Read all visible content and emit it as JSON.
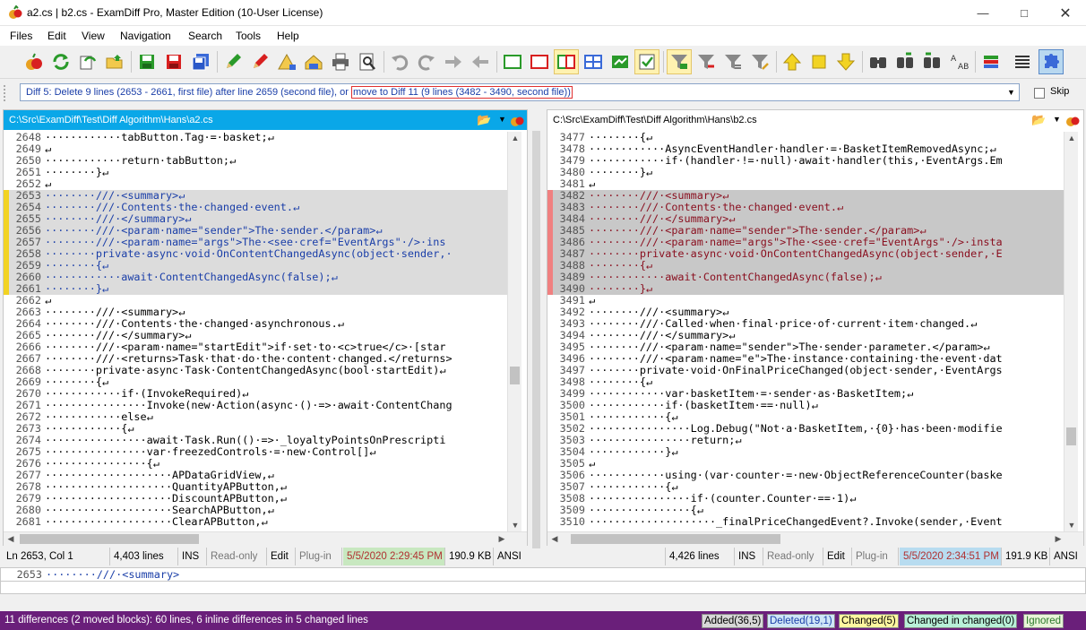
{
  "window": {
    "title": "a2.cs  |  b2.cs - ExamDiff Pro, Master Edition (10-User License)"
  },
  "menu": [
    "Files",
    "Edit",
    "View",
    "Navigation",
    "Search",
    "Tools",
    "Help"
  ],
  "diffnav": {
    "text": "Diff 5: Delete 9 lines (2653 - 2661, first file) after line 2659 (second file), or",
    "move_link": "move to Diff 11 (9 lines (3482 - 3490, second file))",
    "skip_label": "Skip"
  },
  "left": {
    "path": "C:\\Src\\ExamDiff\\Test\\Diff Algorithm\\Hans\\a2.cs",
    "lines": [
      {
        "n": "2648",
        "t": "············tabButton.Tag·=·basket;↵",
        "k": ""
      },
      {
        "n": "2649",
        "t": "↵",
        "k": ""
      },
      {
        "n": "2650",
        "t": "············return·tabButton;↵",
        "k": ""
      },
      {
        "n": "2651",
        "t": "········}↵",
        "k": ""
      },
      {
        "n": "2652",
        "t": "↵",
        "k": ""
      },
      {
        "n": "2653",
        "t": "········///·<summary>↵",
        "k": "del"
      },
      {
        "n": "2654",
        "t": "········///·Contents·the·changed·event.↵",
        "k": "del"
      },
      {
        "n": "2655",
        "t": "········///·</summary>↵",
        "k": "del"
      },
      {
        "n": "2656",
        "t": "········///·<param·name=\"sender\">The·sender.</param>↵",
        "k": "del"
      },
      {
        "n": "2657",
        "t": "········///·<param·name=\"args\">The·<see·cref=\"EventArgs\"·/>·ins",
        "k": "del"
      },
      {
        "n": "2658",
        "t": "········private·async·void·OnContentChangedAsync(object·sender,·",
        "k": "del"
      },
      {
        "n": "2659",
        "t": "········{↵",
        "k": "del"
      },
      {
        "n": "2660",
        "t": "············await·ContentChangedAsync(false);↵",
        "k": "del"
      },
      {
        "n": "2661",
        "t": "········}↵",
        "k": "del"
      },
      {
        "n": "2662",
        "t": "↵",
        "k": ""
      },
      {
        "n": "2663",
        "t": "········///·<summary>↵",
        "k": ""
      },
      {
        "n": "2664",
        "t": "········///·Contents·the·changed·asynchronous.↵",
        "k": ""
      },
      {
        "n": "2665",
        "t": "········///·</summary>↵",
        "k": ""
      },
      {
        "n": "2666",
        "t": "········///·<param·name=\"startEdit\">if·set·to·<c>true</c>·[star",
        "k": ""
      },
      {
        "n": "2667",
        "t": "········///·<returns>Task·that·do·the·content·changed.</returns>",
        "k": ""
      },
      {
        "n": "2668",
        "t": "········private·async·Task·ContentChangedAsync(bool·startEdit)↵",
        "k": ""
      },
      {
        "n": "2669",
        "t": "········{↵",
        "k": ""
      },
      {
        "n": "2670",
        "t": "············if·(InvokeRequired)↵",
        "k": ""
      },
      {
        "n": "2671",
        "t": "················Invoke(new·Action(async·()·=>·await·ContentChang",
        "k": ""
      },
      {
        "n": "2672",
        "t": "············else↵",
        "k": ""
      },
      {
        "n": "2673",
        "t": "············{↵",
        "k": ""
      },
      {
        "n": "2674",
        "t": "················await·Task.Run(()·=>·_loyaltyPointsOnPrescripti",
        "k": ""
      },
      {
        "n": "2675",
        "t": "················var·freezedControls·=·new·Control[]↵",
        "k": ""
      },
      {
        "n": "2676",
        "t": "················{↵",
        "k": ""
      },
      {
        "n": "2677",
        "t": "····················APDataGridView,↵",
        "k": ""
      },
      {
        "n": "2678",
        "t": "····················QuantityAPButton,↵",
        "k": ""
      },
      {
        "n": "2679",
        "t": "····················DiscountAPButton,↵",
        "k": ""
      },
      {
        "n": "2680",
        "t": "····················SearchAPButton,↵",
        "k": ""
      },
      {
        "n": "2681",
        "t": "····················ClearAPButton,↵",
        "k": ""
      }
    ],
    "status": {
      "pos": "Ln 2653, Col 1",
      "lines": "4,403 lines",
      "ins": "INS",
      "ro": "Read-only",
      "edit": "Edit",
      "plugin": "Plug-in",
      "date": "5/5/2020 2:29:45 PM",
      "size": "190.9 KB",
      "enc": "ANSI"
    }
  },
  "right": {
    "path": "C:\\Src\\ExamDiff\\Test\\Diff Algorithm\\Hans\\b2.cs",
    "lines": [
      {
        "n": "3477",
        "t": "········{↵",
        "k": ""
      },
      {
        "n": "3478",
        "t": "············AsyncEventHandler·handler·=·BasketItemRemovedAsync;↵",
        "k": ""
      },
      {
        "n": "3479",
        "t": "············if·(handler·!=·null)·await·handler(this,·EventArgs.Em",
        "k": ""
      },
      {
        "n": "3480",
        "t": "········}↵",
        "k": ""
      },
      {
        "n": "3481",
        "t": "↵",
        "k": ""
      },
      {
        "n": "3482",
        "t": "········///·<summary>↵",
        "k": "add"
      },
      {
        "n": "3483",
        "t": "········///·Contents·the·changed·event.↵",
        "k": "add"
      },
      {
        "n": "3484",
        "t": "········///·</summary>↵",
        "k": "add"
      },
      {
        "n": "3485",
        "t": "········///·<param·name=\"sender\">The·sender.</param>↵",
        "k": "add"
      },
      {
        "n": "3486",
        "t": "········///·<param·name=\"args\">The·<see·cref=\"EventArgs\"·/>·insta",
        "k": "add"
      },
      {
        "n": "3487",
        "t": "········private·async·void·OnContentChangedAsync(object·sender,·E",
        "k": "add"
      },
      {
        "n": "3488",
        "t": "········{↵",
        "k": "add"
      },
      {
        "n": "3489",
        "t": "············await·ContentChangedAsync(false);↵",
        "k": "add"
      },
      {
        "n": "3490",
        "t": "········}↵",
        "k": "add"
      },
      {
        "n": "3491",
        "t": "↵",
        "k": ""
      },
      {
        "n": "3492",
        "t": "········///·<summary>↵",
        "k": ""
      },
      {
        "n": "3493",
        "t": "········///·Called·when·final·price·of·current·item·changed.↵",
        "k": ""
      },
      {
        "n": "3494",
        "t": "········///·</summary>↵",
        "k": ""
      },
      {
        "n": "3495",
        "t": "········///·<param·name=\"sender\">The·sender·parameter.</param>↵",
        "k": ""
      },
      {
        "n": "3496",
        "t": "········///·<param·name=\"e\">The·instance·containing·the·event·dat",
        "k": ""
      },
      {
        "n": "3497",
        "t": "········private·void·OnFinalPriceChanged(object·sender,·EventArgs",
        "k": ""
      },
      {
        "n": "3498",
        "t": "········{↵",
        "k": ""
      },
      {
        "n": "3499",
        "t": "············var·basketItem·=·sender·as·BasketItem;↵",
        "k": ""
      },
      {
        "n": "3500",
        "t": "············if·(basketItem·==·null)↵",
        "k": ""
      },
      {
        "n": "3501",
        "t": "············{↵",
        "k": ""
      },
      {
        "n": "3502",
        "t": "················Log.Debug(\"Not·a·BasketItem,·{0}·has·been·modifie",
        "k": ""
      },
      {
        "n": "3503",
        "t": "················return;↵",
        "k": ""
      },
      {
        "n": "3504",
        "t": "············}↵",
        "k": ""
      },
      {
        "n": "3505",
        "t": "↵",
        "k": ""
      },
      {
        "n": "3506",
        "t": "············using·(var·counter·=·new·ObjectReferenceCounter(baske",
        "k": ""
      },
      {
        "n": "3507",
        "t": "············{↵",
        "k": ""
      },
      {
        "n": "3508",
        "t": "················if·(counter.Counter·==·1)↵",
        "k": ""
      },
      {
        "n": "3509",
        "t": "················{↵",
        "k": ""
      },
      {
        "n": "3510",
        "t": "····················_finalPriceChangedEvent?.Invoke(sender,·Event",
        "k": ""
      }
    ],
    "status": {
      "lines": "4,426 lines",
      "ins": "INS",
      "ro": "Read-only",
      "edit": "Edit",
      "plugin": "Plug-in",
      "date": "5/5/2020 2:34:51 PM",
      "size": "191.9 KB",
      "enc": "ANSI"
    }
  },
  "bottom": {
    "line_number": "2653",
    "line_text": "········///·<summary>"
  },
  "summary": {
    "text": "11 differences (2 moved blocks): 60 lines, 6 inline differences in 5 changed lines",
    "badges": [
      "Added(36,5)",
      "Deleted(19,1)",
      "Changed(5)",
      "Changed in changed(0)",
      "Ignored"
    ]
  },
  "colors": {
    "accent": "#0aa7e8",
    "deleted_bg": "#dcdcdc",
    "added_bg": "#c8c8c8",
    "moved_bar_left": "#f2d323",
    "moved_bar_right": "#f08080",
    "summary_bg": "#6a1f7a"
  }
}
